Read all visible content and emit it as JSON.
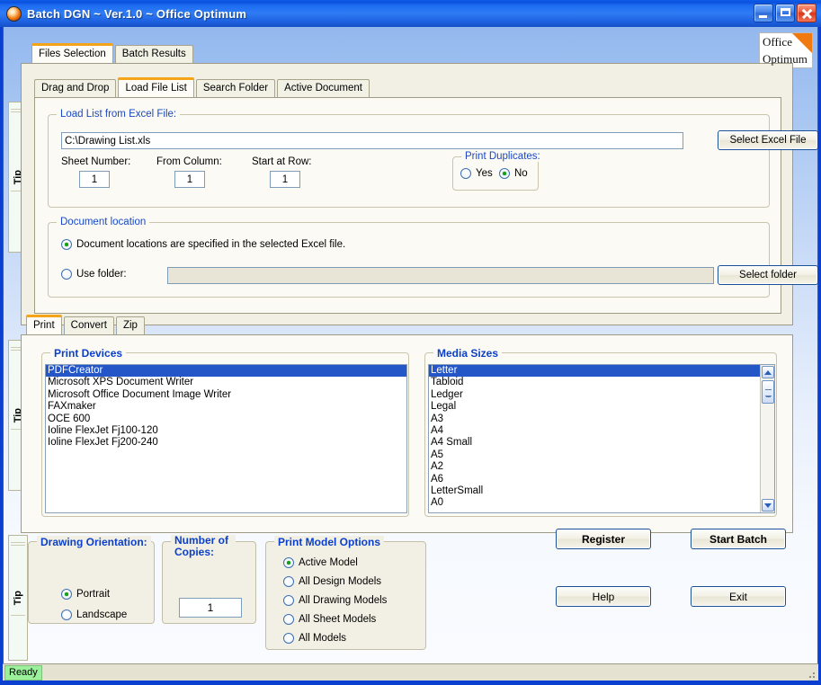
{
  "window": {
    "title": "Batch DGN ~ Ver.1.0 ~ Office Optimum",
    "icon": "app-circle-icon",
    "minimize_label": "_",
    "maximize_label": "□",
    "close_label": "×"
  },
  "logo": {
    "line1": "Office",
    "line2": "Optimum"
  },
  "main_tabs": [
    {
      "label": "Files Selection",
      "active": true
    },
    {
      "label": "Batch Results",
      "active": false
    }
  ],
  "sub_tabs": [
    {
      "label": "Drag and Drop",
      "active": false
    },
    {
      "label": "Load File List",
      "active": true
    },
    {
      "label": "Search Folder",
      "active": false
    },
    {
      "label": "Active Document",
      "active": false
    }
  ],
  "excel_group": {
    "legend": "Load List from Excel File:",
    "file_path": "C:\\Drawing List.xls",
    "file_placeholder": "",
    "select_excel_button": "Select Excel File",
    "sheet_number_label": "Sheet Number:",
    "sheet_number_value": "1",
    "from_column_label": "From Column:",
    "from_column_value": "1",
    "start_at_row_label": "Start at Row:",
    "start_at_row_value": "1",
    "print_duplicates": {
      "legend": "Print Duplicates:",
      "yes_label": "Yes",
      "no_label": "No",
      "selected": "No"
    }
  },
  "document_location": {
    "legend": "Document location",
    "option_excel_label": "Document locations are specified in the selected Excel file.",
    "option_folder_label": "Use folder:",
    "folder_value": "",
    "folder_placeholder": "",
    "select_folder_button": "Select folder",
    "selected": "excel"
  },
  "action_tabs": [
    {
      "label": "Print",
      "active": true
    },
    {
      "label": "Convert",
      "active": false
    },
    {
      "label": "Zip",
      "active": false
    }
  ],
  "print_devices": {
    "legend": "Print Devices",
    "items": [
      "PDFCreator",
      "Microsoft XPS Document Writer",
      "Microsoft Office Document Image Writer",
      "FAXmaker",
      "OCE 600",
      "Ioline FlexJet Fj100-120",
      "Ioline FlexJet Fj200-240"
    ],
    "selected_index": 0
  },
  "media_sizes": {
    "legend": "Media Sizes",
    "items": [
      "Letter",
      "Tabloid",
      "Ledger",
      "Legal",
      "A3",
      "A4",
      "A4 Small",
      "A5",
      "A2",
      "A6",
      "LetterSmall",
      "A0"
    ],
    "selected_index": 0,
    "scroll_up_icon": "chevron-up-icon",
    "scroll_down_icon": "chevron-down-icon"
  },
  "drawing_orientation": {
    "legend": "Drawing Orientation:",
    "options": [
      "Portrait",
      "Landscape"
    ],
    "selected": "Portrait"
  },
  "number_of_copies": {
    "legend": "Number of Copies:",
    "value": "1"
  },
  "print_model_options": {
    "legend": "Print Model Options",
    "options": [
      "Active Model",
      "All Design Models",
      "All Drawing Models",
      "All Sheet Models",
      "All Models"
    ],
    "selected": "Active Model"
  },
  "buttons": {
    "register": "Register",
    "start_batch": "Start Batch",
    "help": "Help",
    "exit": "Exit"
  },
  "tips": [
    {
      "label": "Tip"
    },
    {
      "label": "Tip"
    },
    {
      "label": "Tip"
    }
  ],
  "statusbar": {
    "text": "Ready"
  },
  "colors": {
    "titlebar_blue": "#2f7cf5",
    "frame_blue": "#0a3fd0",
    "accent_orange": "#f5a417",
    "group_label_blue": "#1a49c4",
    "selection_blue": "#2456c8",
    "status_green": "#9bf09b",
    "panel_beige": "#f2f0e4"
  }
}
